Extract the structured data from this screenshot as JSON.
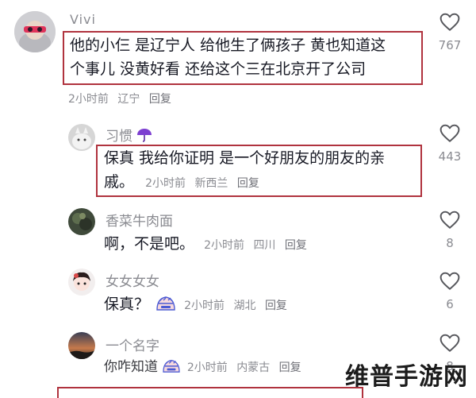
{
  "comments": [
    {
      "id": "c1",
      "username": "Vivi",
      "text_line1": "他的小仨 是辽宁人 给他生了俩孩子 黄也知道这",
      "text_line2": "个事儿 没黄好看 还给这个三在北京开了公司",
      "time": "2小时前",
      "location": "辽宁",
      "reply": "回复",
      "likes": "767"
    },
    {
      "id": "c2",
      "username": "习惯",
      "username_emoji": "umbrella-emoji",
      "text_line1": "保真 我给你证明 是一个好朋友的朋友的亲",
      "text_line2": "戚。",
      "time": "2小时前",
      "location": "新西兰",
      "reply": "回复",
      "likes": "443"
    },
    {
      "id": "c3",
      "username": "香菜牛肉面",
      "text": "啊，不是吧。",
      "time": "2小时前",
      "location": "四川",
      "reply": "回复",
      "likes": "8"
    },
    {
      "id": "c4",
      "username": "女女女女",
      "text": "保真？",
      "text_emoji": "sweating-emoji",
      "time": "2小时前",
      "location": "湖北",
      "reply": "回复",
      "likes": "6"
    },
    {
      "id": "c5",
      "username": "一个名字",
      "text": "你咋知道",
      "text_emoji": "sweating-emoji",
      "time": "2小时前",
      "location": "内蒙古",
      "reply": "回复",
      "likes": "8"
    }
  ],
  "watermark": "维普手游网",
  "colors": {
    "highlight_box": "#b0333e",
    "meta_text": "#8a8b91",
    "body_text": "#161823"
  }
}
